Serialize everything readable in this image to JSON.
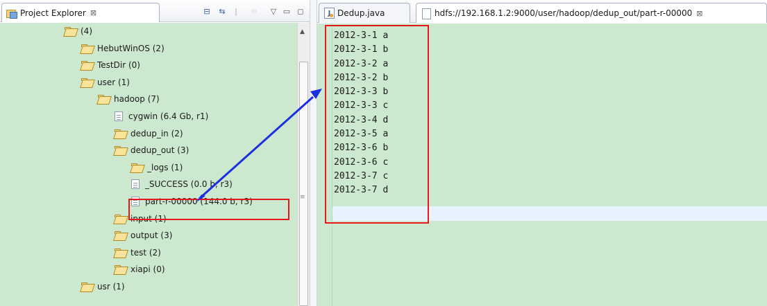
{
  "left_panel": {
    "tab_title": "Project Explorer",
    "tab_close_glyph": "⊠"
  },
  "tree": [
    {
      "label": "(4)",
      "icon": "folder-icon",
      "depth": 0
    },
    {
      "label": "HebutWinOS (2)",
      "icon": "folder-icon",
      "depth": 1
    },
    {
      "label": "TestDir (0)",
      "icon": "folder-icon",
      "depth": 1
    },
    {
      "label": "user (1)",
      "icon": "folder-icon",
      "depth": 1
    },
    {
      "label": "hadoop (7)",
      "icon": "folder-icon",
      "depth": 2
    },
    {
      "label": "cygwin (6.4 Gb, r1)",
      "icon": "file-icon",
      "depth": 3
    },
    {
      "label": "dedup_in (2)",
      "icon": "folder-icon",
      "depth": 3
    },
    {
      "label": "dedup_out (3)",
      "icon": "folder-icon",
      "depth": 3
    },
    {
      "label": "_logs (1)",
      "icon": "folder-icon",
      "depth": 4
    },
    {
      "label": "_SUCCESS (0.0 b, r3)",
      "icon": "file-icon",
      "depth": 4
    },
    {
      "label": "part-r-00000 (144.0 b, r3)",
      "icon": "file-icon",
      "depth": 4,
      "highlighted": true
    },
    {
      "label": "input (1)",
      "icon": "folder-icon",
      "depth": 3
    },
    {
      "label": "output (3)",
      "icon": "folder-icon",
      "depth": 3
    },
    {
      "label": "test (2)",
      "icon": "folder-icon",
      "depth": 3
    },
    {
      "label": "xiapi (0)",
      "icon": "folder-icon",
      "depth": 3
    },
    {
      "label": "usr (1)",
      "icon": "folder-icon",
      "depth": 1
    }
  ],
  "editor": {
    "tabs": [
      {
        "label": "Dedup.java",
        "icon": "java-file-icon"
      },
      {
        "label": "hdfs://192.168.1.2:9000/user/hadoop/dedup_out/part-r-00000",
        "icon": "document-icon",
        "close_glyph": "⊠"
      }
    ],
    "lines": [
      "2012-3-1 a",
      "2012-3-1 b",
      "2012-3-2 a",
      "2012-3-2 b",
      "2012-3-3 b",
      "2012-3-3 c",
      "2012-3-4 d",
      "2012-3-5 a",
      "2012-3-6 b",
      "2012-3-6 c",
      "2012-3-7 c",
      "2012-3-7 d"
    ]
  },
  "colors": {
    "tree_bg": "#cce8cf",
    "editor_bg": "#cce8cf",
    "highlight_box": "#e8151b",
    "arrow": "#1a2fe0",
    "cursor_line": "#e8f2fe"
  }
}
